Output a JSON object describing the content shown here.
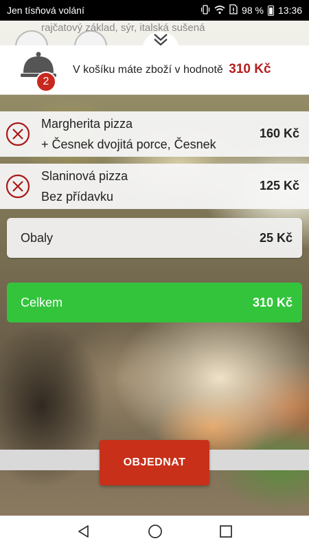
{
  "status_bar": {
    "carrier": "Jen tísňová volání",
    "battery": "98 %",
    "time": "13:36"
  },
  "behind_list": {
    "text": "rajčatový základ, sýr, italská sušená"
  },
  "header": {
    "badge_count": "2",
    "cart_text": "V košíku máte zboží v hodnotě",
    "cart_total": "310 Kč"
  },
  "items": [
    {
      "name": "Margherita pizza",
      "extras": "+ Česnek dvojitá porce, Česnek",
      "price": "160 Kč"
    },
    {
      "name": "Slaninová pizza",
      "extras": "Bez přídavku",
      "price": "125 Kč"
    }
  ],
  "packaging": {
    "label": "Obaly",
    "value": "25 Kč"
  },
  "total": {
    "label": "Celkem",
    "value": "310 Kč"
  },
  "order_button": {
    "label": "OBJEDNAT"
  },
  "colors": {
    "accent_red": "#c8301a",
    "total_green": "#33c43c",
    "price_red": "#b71c1c"
  },
  "icons": [
    "vibrate-icon",
    "wifi-icon",
    "sim-alert-icon",
    "battery-icon",
    "chevron-double-down-icon",
    "cloche-icon",
    "remove-circle-icon",
    "back-icon",
    "home-icon",
    "recents-icon"
  ]
}
